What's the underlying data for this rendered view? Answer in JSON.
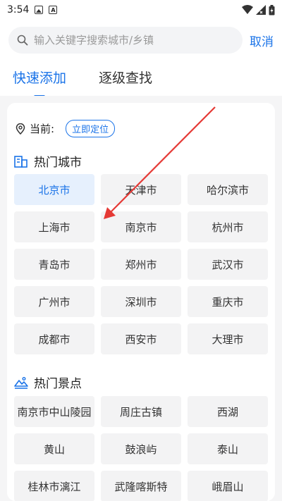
{
  "status_bar": {
    "time": "3:54"
  },
  "search": {
    "placeholder": "输入关键字搜索城市/乡镇",
    "cancel_label": "取消"
  },
  "tabs": [
    {
      "label": "快速添加",
      "active": true
    },
    {
      "label": "逐级查找",
      "active": false
    }
  ],
  "location": {
    "label": "当前:",
    "locate_button": "立即定位"
  },
  "hot_cities": {
    "title": "热门城市",
    "items": [
      "北京市",
      "天津市",
      "哈尔滨市",
      "上海市",
      "南京市",
      "杭州市",
      "青岛市",
      "郑州市",
      "武汉市",
      "广州市",
      "深圳市",
      "重庆市",
      "成都市",
      "西安市",
      "大理市"
    ]
  },
  "hot_spots": {
    "title": "热门景点",
    "items": [
      "南京市中山陵园",
      "周庄古镇",
      "西湖",
      "黄山",
      "鼓浪屿",
      "泰山",
      "桂林市漓江",
      "武隆喀斯特",
      "峨眉山"
    ]
  },
  "colors": {
    "accent": "#1a73e8",
    "annotation_arrow": "#e53935"
  }
}
